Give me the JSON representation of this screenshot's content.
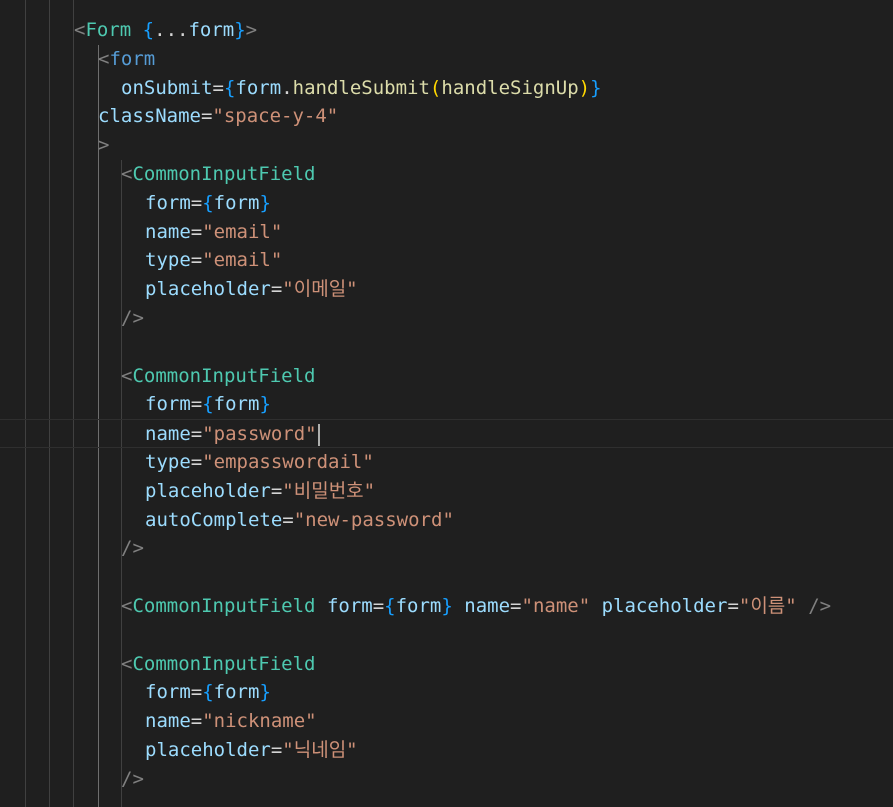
{
  "editor": {
    "theme_colors": {
      "background": "#1f1f1f",
      "component_tag": "#4ec9b0",
      "html_tag": "#569cd6",
      "attribute": "#9cdcfe",
      "string": "#ce9178",
      "brace": "#179fff",
      "function": "#dcdcaa",
      "punctuation": "#808080"
    },
    "lines": [
      {
        "tokens": [
          [
            "<",
            "punct"
          ],
          [
            "Form",
            "tag"
          ],
          [
            " ",
            "op"
          ],
          [
            "{",
            "brace"
          ],
          [
            "...",
            "op"
          ],
          [
            "form",
            "attr"
          ],
          [
            "}",
            "brace"
          ],
          [
            ">",
            "punct"
          ]
        ]
      },
      {
        "tokens": [
          [
            "<",
            "punct"
          ],
          [
            "form",
            "htmltag"
          ]
        ]
      },
      {
        "tokens": [
          [
            "onSubmit",
            "attr"
          ],
          [
            "=",
            "op"
          ],
          [
            "{",
            "brace"
          ],
          [
            "form",
            "attr"
          ],
          [
            ".",
            "op"
          ],
          [
            "handleSubmit",
            "fn"
          ],
          [
            "(",
            "paren"
          ],
          [
            "handleSignUp",
            "fn"
          ],
          [
            ")",
            "paren"
          ],
          [
            "}",
            "brace"
          ]
        ]
      },
      {
        "tokens": [
          [
            "className",
            "attr"
          ],
          [
            "=",
            "op"
          ],
          [
            "\"space-y-4\"",
            "str"
          ]
        ]
      },
      {
        "tokens": [
          [
            ">",
            "punct"
          ]
        ]
      },
      {
        "tokens": [
          [
            "<",
            "punct"
          ],
          [
            "CommonInputField",
            "tag"
          ]
        ]
      },
      {
        "tokens": [
          [
            "form",
            "attr"
          ],
          [
            "=",
            "op"
          ],
          [
            "{",
            "brace"
          ],
          [
            "form",
            "attr"
          ],
          [
            "}",
            "brace"
          ]
        ]
      },
      {
        "tokens": [
          [
            "name",
            "attr"
          ],
          [
            "=",
            "op"
          ],
          [
            "\"email\"",
            "str"
          ]
        ]
      },
      {
        "tokens": [
          [
            "type",
            "attr"
          ],
          [
            "=",
            "op"
          ],
          [
            "\"email\"",
            "str"
          ]
        ]
      },
      {
        "tokens": [
          [
            "placeholder",
            "attr"
          ],
          [
            "=",
            "op"
          ],
          [
            "\"이메일\"",
            "str"
          ]
        ]
      },
      {
        "tokens": [
          [
            "/>",
            "punct"
          ]
        ]
      },
      {
        "tokens": []
      },
      {
        "tokens": [
          [
            "<",
            "punct"
          ],
          [
            "CommonInputField",
            "tag"
          ]
        ]
      },
      {
        "tokens": [
          [
            "form",
            "attr"
          ],
          [
            "=",
            "op"
          ],
          [
            "{",
            "brace"
          ],
          [
            "form",
            "attr"
          ],
          [
            "}",
            "brace"
          ]
        ]
      },
      {
        "tokens": [
          [
            "name",
            "attr"
          ],
          [
            "=",
            "op"
          ],
          [
            "\"password\"",
            "str"
          ]
        ],
        "cursor": true
      },
      {
        "tokens": [
          [
            "type",
            "attr"
          ],
          [
            "=",
            "op"
          ],
          [
            "\"empasswordail\"",
            "str"
          ]
        ]
      },
      {
        "tokens": [
          [
            "placeholder",
            "attr"
          ],
          [
            "=",
            "op"
          ],
          [
            "\"비밀번호\"",
            "str"
          ]
        ]
      },
      {
        "tokens": [
          [
            "autoComplete",
            "attr"
          ],
          [
            "=",
            "op"
          ],
          [
            "\"new-password\"",
            "str"
          ]
        ]
      },
      {
        "tokens": [
          [
            "/>",
            "punct"
          ]
        ]
      },
      {
        "tokens": []
      },
      {
        "tokens": [
          [
            "<",
            "punct"
          ],
          [
            "CommonInputField",
            "tag"
          ],
          [
            " ",
            "op"
          ],
          [
            "form",
            "attr"
          ],
          [
            "=",
            "op"
          ],
          [
            "{",
            "brace"
          ],
          [
            "form",
            "attr"
          ],
          [
            "}",
            "brace"
          ],
          [
            " ",
            "op"
          ],
          [
            "name",
            "attr"
          ],
          [
            "=",
            "op"
          ],
          [
            "\"name\"",
            "str"
          ],
          [
            " ",
            "op"
          ],
          [
            "placeholder",
            "attr"
          ],
          [
            "=",
            "op"
          ],
          [
            "\"이름\"",
            "str"
          ],
          [
            " ",
            "op"
          ],
          [
            "/>",
            "punct"
          ]
        ]
      },
      {
        "tokens": []
      },
      {
        "tokens": [
          [
            "<",
            "punct"
          ],
          [
            "CommonInputField",
            "tag"
          ]
        ]
      },
      {
        "tokens": [
          [
            "form",
            "attr"
          ],
          [
            "=",
            "op"
          ],
          [
            "{",
            "brace"
          ],
          [
            "form",
            "attr"
          ],
          [
            "}",
            "brace"
          ]
        ]
      },
      {
        "tokens": [
          [
            "name",
            "attr"
          ],
          [
            "=",
            "op"
          ],
          [
            "\"nickname\"",
            "str"
          ]
        ]
      },
      {
        "tokens": [
          [
            "placeholder",
            "attr"
          ],
          [
            "=",
            "op"
          ],
          [
            "\"닉네임\"",
            "str"
          ]
        ]
      },
      {
        "tokens": [
          [
            "/>",
            "punct"
          ]
        ]
      }
    ]
  }
}
